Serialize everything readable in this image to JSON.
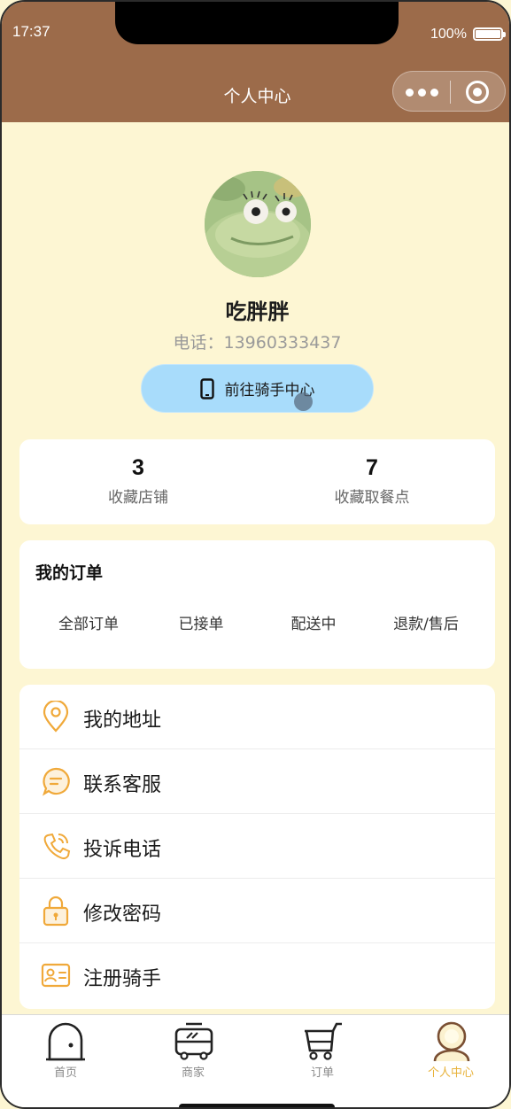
{
  "status_bar": {
    "time": "17:37",
    "battery": "100%"
  },
  "header": {
    "title": "个人中心"
  },
  "profile": {
    "name": "吃胖胖",
    "phone": "电话：13960333437",
    "rider_button_label": "前往骑手中心"
  },
  "stats": [
    {
      "value": "3",
      "label": "收藏店铺"
    },
    {
      "value": "7",
      "label": "收藏取餐点"
    }
  ],
  "orders": {
    "title": "我的订单",
    "tabs": [
      "全部订单",
      "已接单",
      "配送中",
      "退款/售后"
    ]
  },
  "menu": [
    {
      "label": "我的地址",
      "icon": "location-pin-icon"
    },
    {
      "label": "联系客服",
      "icon": "chat-bubble-icon"
    },
    {
      "label": "投诉电话",
      "icon": "phone-call-icon"
    },
    {
      "label": "修改密码",
      "icon": "lock-icon"
    },
    {
      "label": "注册骑手",
      "icon": "id-card-icon"
    }
  ],
  "tabbar": [
    {
      "label": "首页",
      "icon": "home-icon",
      "active": false
    },
    {
      "label": "商家",
      "icon": "bus-icon",
      "active": false
    },
    {
      "label": "订单",
      "icon": "cart-icon",
      "active": false
    },
    {
      "label": "个人中心",
      "icon": "user-icon",
      "active": true
    }
  ],
  "colors": {
    "header_bg": "#9c6b4a",
    "page_bg": "#fdf6d3",
    "rider_button_bg": "#a8dcfb",
    "accent": "#e8b23a",
    "menu_icon": "#f0a93a"
  }
}
